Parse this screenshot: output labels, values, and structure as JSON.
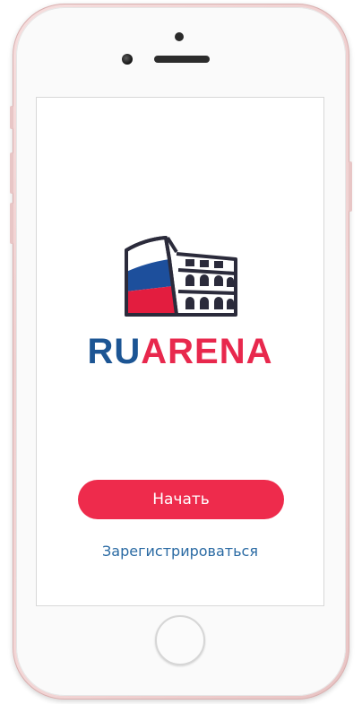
{
  "app": {
    "brand_part1": "RU",
    "brand_part2": "ARENA"
  },
  "actions": {
    "start_label": "Начать",
    "register_label": "Зарегистрироваться"
  },
  "colors": {
    "brand_blue": "#1c5594",
    "brand_red": "#e8284d",
    "button_bg": "#ee2b4c",
    "link": "#2a6aa3",
    "flag_white": "#ffffff",
    "flag_blue": "#1d4f9c",
    "flag_red": "#e31d3f",
    "logo_outline": "#2b2b3b"
  },
  "icons": {
    "logo": "colosseum-russian-flag-icon"
  }
}
